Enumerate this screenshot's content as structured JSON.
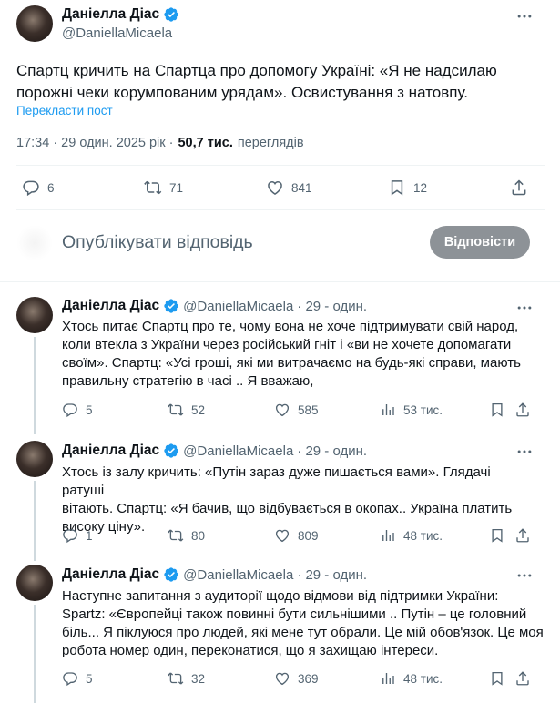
{
  "main_tweet": {
    "author_name": "Даніелла Діас",
    "handle": "@DaniellaMicaela",
    "text_line1": "Спартц кричить на Спартца про допомогу Україні: «Я не надсилаю",
    "text_line2": "порожні чеки корумпованим урядам». Освистування з натовпу.",
    "translate": "Перекласти пост",
    "time": "17:34 · 29 один. 2025 рік ·",
    "views_count": "50,7 тис.",
    "views_label": "переглядів",
    "stats": {
      "replies": "6",
      "reposts": "71",
      "likes": "841",
      "bookmarks": "12"
    }
  },
  "reply_box": {
    "placeholder": "Опублікувати відповідь",
    "button": "Відповісти"
  },
  "replies": [
    {
      "author_name": "Даніелла Діас",
      "handle": "@DaniellaMicaela",
      "date": "· 29 - один.",
      "lines": [
        "Хтось питає Спартц про те, чому вона не хоче підтримувати свій народ,",
        "коли втекла з України через російський гніт і «ви не хочете допомагати",
        "своїм». Спартц: «Усі гроші, які ми витрачаємо на будь-які справи, мають",
        "правильну стратегію в часі .. Я вважаю,"
      ],
      "stats": {
        "replies": "5",
        "reposts": "52",
        "likes": "585",
        "views": "53 тис."
      }
    },
    {
      "author_name": "Даніелла Діас",
      "handle": "@DaniellaMicaela",
      "date": "· 29 - один.",
      "lines": [
        "Хтось із залу кричить: «Путін зараз дуже пишається вами». Глядачі ратуші",
        "вітають. Спартц: «Я бачив, що відбувається в окопах.. Україна платить",
        "високу ціну»."
      ],
      "stats": {
        "replies": "1",
        "reposts": "80",
        "likes": "809",
        "views": "48 тис."
      }
    },
    {
      "author_name": "Даніелла Діас",
      "handle": "@DaniellaMicaela",
      "date": "· 29 - один.",
      "lines": [
        "Наступне запитання з аудиторії щодо відмови від підтримки України:",
        "Spartz: «Європейці також повинні бути сильнішими .. Путін – це головний",
        "біль... Я піклуюся про людей, які мене тут обрали. Це мій обов'язок. Це моя",
        "робота номер один, переконатися, що я захищаю інтереси."
      ],
      "stats": {
        "replies": "5",
        "reposts": "32",
        "likes": "369",
        "views": "48 тис."
      }
    }
  ],
  "colors": {
    "accent": "#1d9bf0",
    "muted": "#536471",
    "button_disabled": "#8d9297"
  }
}
